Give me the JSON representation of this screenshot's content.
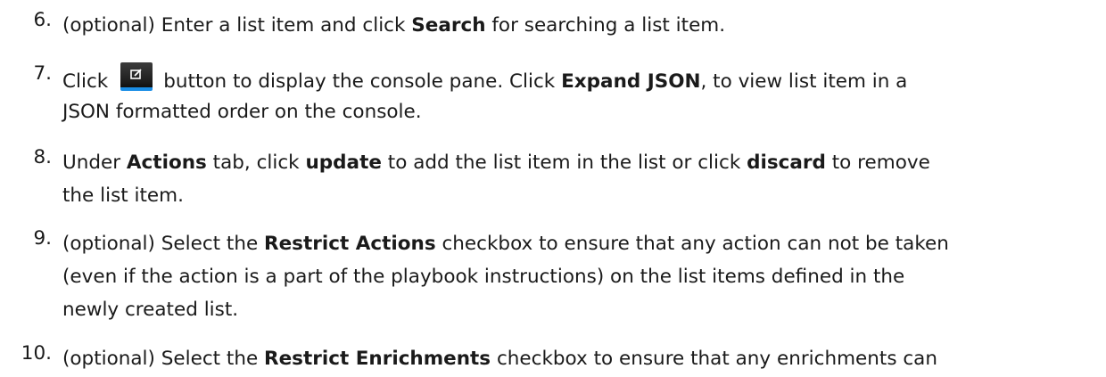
{
  "steps": [
    {
      "number": "6.",
      "lines": [
        {
          "t1": "(optional) Enter a list item and click ",
          "b1": "Search",
          "t2": " for searching a list item."
        }
      ]
    },
    {
      "number": "7.",
      "icon": "console-pane-icon",
      "lines": [
        {
          "t1": "Click",
          "t2": "button to display the console pane. Click ",
          "b1": "Expand JSON",
          "t3": ", to view list item in a"
        },
        {
          "t1": "JSON formatted order on the console."
        }
      ]
    },
    {
      "number": "8.",
      "lines": [
        {
          "t1": "Under ",
          "b1": "Actions",
          "t2": " tab, click ",
          "b2": "update",
          "t3": " to add the list item in the list or click ",
          "b3": "discard",
          "t4": " to remove"
        },
        {
          "t1": "the list item."
        }
      ]
    },
    {
      "number": "9.",
      "lines": [
        {
          "t1": "(optional) Select the ",
          "b1": "Restrict Actions",
          "t2": " checkbox to ensure that any action can not be taken"
        },
        {
          "t1": "(even if the action is a part of the playbook instructions) on the list items defined in the"
        },
        {
          "t1": "newly created list."
        }
      ]
    },
    {
      "number": "10.",
      "lines": [
        {
          "t1": "(optional) Select the ",
          "b1": "Restrict Enrichments",
          "t2": " checkbox to ensure that any enrichments can"
        }
      ]
    }
  ],
  "colors": {
    "text": "#1a1a1a",
    "button_bg": "#1e1e1e",
    "button_accent": "#1b8ee6"
  }
}
